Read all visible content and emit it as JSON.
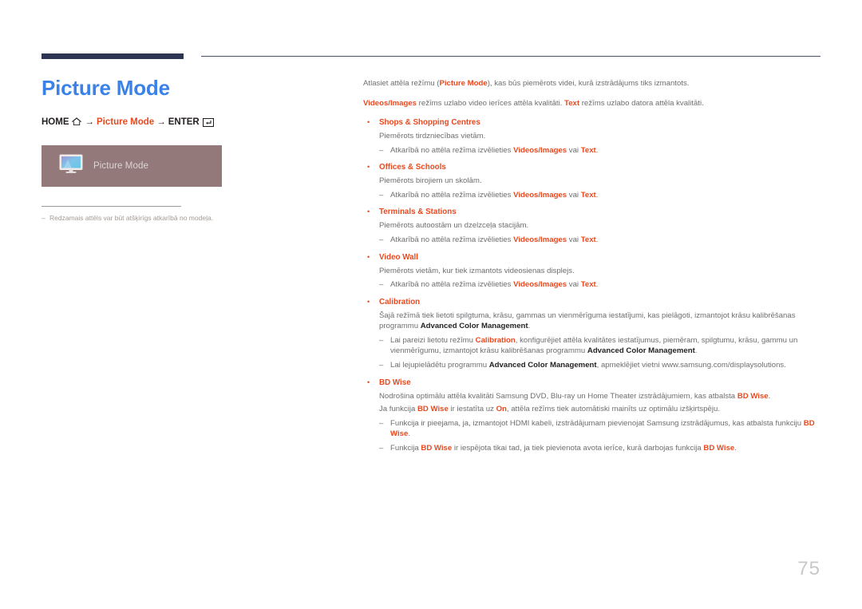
{
  "header": {
    "rule_color_thick": "#2e3552",
    "rule_color_thin": "#4b4f6b"
  },
  "left": {
    "title": "Picture Mode",
    "title_color": "#3b82e8",
    "breadcrumb": {
      "home_label": "HOME",
      "home_icon": "home-icon",
      "arrow1": "→",
      "middle_label": "Picture Mode",
      "arrow2": "→",
      "enter_label": "ENTER",
      "enter_icon": "enter-key-icon",
      "highlight_color": "#e8491f"
    },
    "menu_preview": {
      "label": "Picture Mode",
      "icon": "monitor-display-icon",
      "background": "#93797a",
      "label_color": "#ded5d4"
    },
    "note": {
      "dash": "–",
      "text": "Redzamais attēls var būt atšķirīgs atkarībā no modeļa."
    }
  },
  "right": {
    "intro1": {
      "a": "Atlasiet attēla režīmu (",
      "hl": "Picture Mode",
      "b": "), kas būs piemērots videi, kurā izstrādājums tiks izmantots."
    },
    "intro2": {
      "hl1": "Videos/Images",
      "a": " režīms uzlabo video ierīces attēla kvalitāti. ",
      "hl2": "Text",
      "b": " režīms uzlabo datora attēla kvalitāti."
    },
    "bullet_glyph": "•",
    "dash_glyph": "–",
    "sections": [
      {
        "head": "Shops & Shopping Centres",
        "body": "Piemērots tirdzniecības vietām.",
        "sub": [
          {
            "a": "Atkarībā no attēla režīma izvēlieties ",
            "hl1": "Videos/Images",
            "b": " vai ",
            "hl2": "Text",
            "c": "."
          }
        ]
      },
      {
        "head": "Offices & Schools",
        "body": "Piemērots birojiem un skolām.",
        "sub": [
          {
            "a": "Atkarībā no attēla režīma izvēlieties ",
            "hl1": "Videos/Images",
            "b": " vai ",
            "hl2": "Text",
            "c": "."
          }
        ]
      },
      {
        "head": "Terminals & Stations",
        "body": "Piemērots autoostām un dzelzceļa stacijām.",
        "sub": [
          {
            "a": "Atkarībā no attēla režīma izvēlieties ",
            "hl1": "Videos/Images",
            "b": " vai ",
            "hl2": "Text",
            "c": "."
          }
        ]
      },
      {
        "head": "Video Wall",
        "body": "Piemērots vietām, kur tiek izmantots videosienas displejs.",
        "sub": [
          {
            "a": "Atkarībā no attēla režīma izvēlieties ",
            "hl1": "Videos/Images",
            "b": " vai ",
            "hl2": "Text",
            "c": "."
          }
        ]
      }
    ],
    "calibration": {
      "head": "Calibration",
      "body_a": "Šajā režīmā tiek lietoti spilgtuma, krāsu, gammas un vienmērīguma iestatījumi, kas pielāgoti, izmantojot krāsu kalibrēšanas programmu ",
      "body_bold": "Advanced Color Management",
      "body_b": ".",
      "sub1_a": "Lai pareizi lietotu režīmu ",
      "sub1_hl": "Calibration",
      "sub1_b": ", konfigurējiet attēla kvalitātes iestatījumus, piemēram, spilgtumu, krāsu, gammu un vienmērīgumu, izmantojot krāsu kalibrēšanas programmu ",
      "sub1_bold": "Advanced Color Management",
      "sub1_c": ".",
      "sub2_a": "Lai lejupielādētu programmu ",
      "sub2_bold": "Advanced Color Management",
      "sub2_b": ", apmeklējiet vietni www.samsung.com/displaysolutions."
    },
    "bdwise": {
      "head": "BD Wise",
      "body1_a": "Nodrošina optimālu attēla kvalitāti Samsung DVD, Blu-ray un Home Theater izstrādājumiem, kas atbalsta ",
      "body1_hl": "BD Wise",
      "body1_b": ".",
      "body2_a": "Ja funkcija ",
      "body2_hl1": "BD Wise",
      "body2_b": " ir iestatīta uz ",
      "body2_hl2": "On",
      "body2_c": ", attēla režīms tiek automātiski mainīts uz optimālu izšķirtspēju.",
      "sub1_a": "Funkcija ir pieejama, ja, izmantojot HDMI kabeli, izstrādājumam pievienojat Samsung izstrādājumus, kas atbalsta funkciju ",
      "sub1_hl": "BD Wise",
      "sub1_b": ".",
      "sub2_a": "Funkcija ",
      "sub2_hl1": "BD Wise",
      "sub2_b": " ir iespējota tikai tad, ja tiek pievienota avota ierīce, kurā darbojas funkcija ",
      "sub2_hl2": "BD Wise",
      "sub2_c": "."
    }
  },
  "footer": {
    "page_number": "75"
  }
}
